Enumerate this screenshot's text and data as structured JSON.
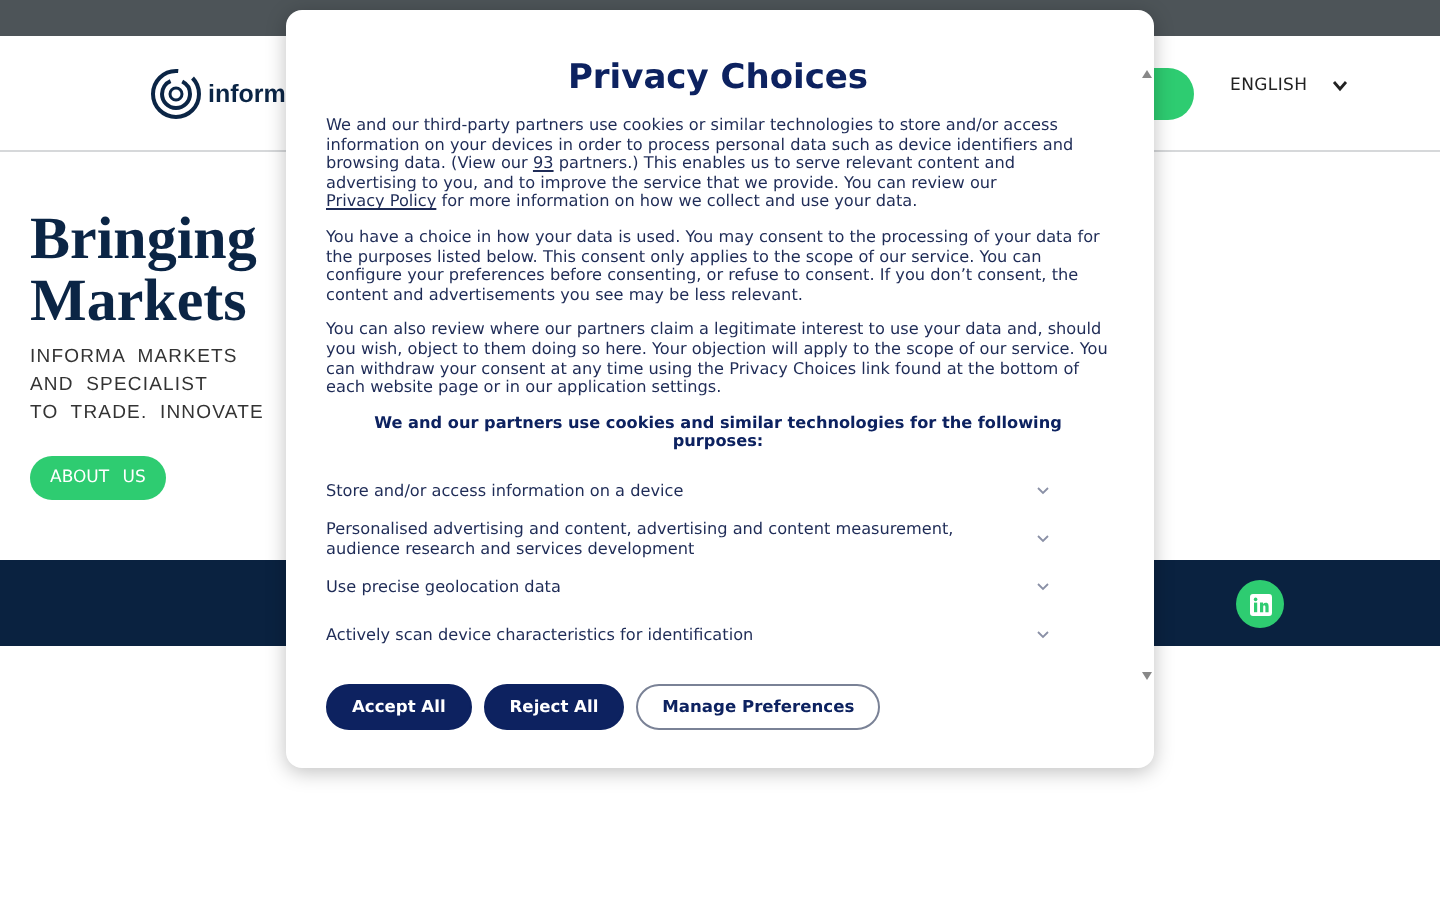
{
  "header": {
    "logo_text": "inform",
    "language": "ENGLISH"
  },
  "hero": {
    "title_lines": [
      "Bringing",
      "Markets"
    ],
    "subtitle_lines": [
      "INFORMA MARKETS",
      "AND SPECIALIST",
      "TO TRADE. INNOVATE"
    ],
    "button": "ABOUT US"
  },
  "dialog": {
    "title": "Privacy Choices",
    "intro": {
      "text_1": "We and our third-party partners use cookies or similar technologies to store and/or access information on your devices in order to process personal data such as device identifiers and browsing data. (View our ",
      "link_1": "93",
      "text_2": " partners.) This enables us to serve relevant content and advertising to you, and to improve the service that we provide. You can review our ",
      "link_2": "Privacy Policy",
      "text_3": " for more information on how we collect and use your data."
    },
    "paragraphs": [
      "You have a choice in how your data is used. You may consent to the processing of your data for the purposes listed below. This consent only applies to the scope of our service. You can configure your preferences before consenting, or refuse to consent. If you don’t consent, the content and advertisements you see may be less relevant.",
      "You can also review where our partners claim a legitimate interest to use your data and, should you wish, object to them doing so here. Your objection will apply to the scope of our service. You can withdraw your consent at any time using the Privacy Choices link found at the bottom of each website page or in our application settings."
    ],
    "purposes_heading": "We and our partners use cookies and similar technologies for the following purposes:",
    "purposes": [
      {
        "label": "Store and/or access information on a device",
        "expanded": false
      },
      {
        "label": "Personalised advertising and content, advertising and content measurement, audience research and services development",
        "expanded": false
      },
      {
        "label": "Use precise geolocation data",
        "expanded": false
      },
      {
        "label": "Actively scan device characteristics for identification",
        "expanded": false
      }
    ],
    "buttons": [
      {
        "label": "Accept All",
        "kind": "primary"
      },
      {
        "label": "Reject All",
        "kind": "primary"
      },
      {
        "label": "Manage Preferences",
        "kind": "outline"
      }
    ]
  }
}
